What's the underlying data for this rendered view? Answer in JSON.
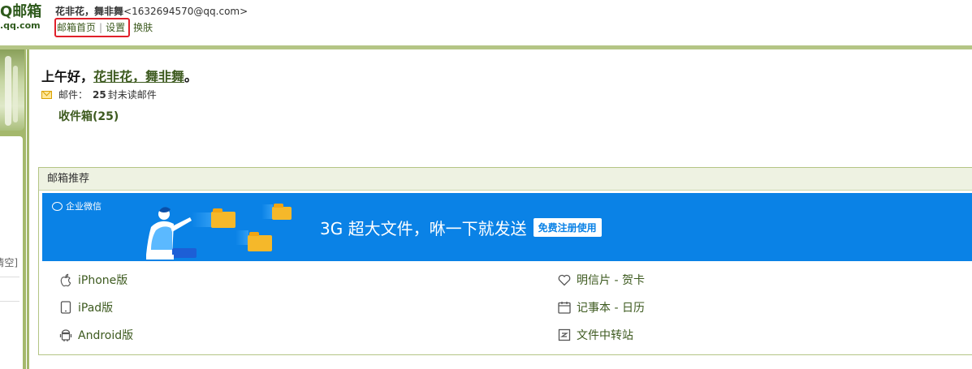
{
  "header": {
    "logo_main": "Q邮箱",
    "logo_sub": ".qq.com",
    "user_name": "花非花，舞非舞",
    "user_email": "<1632694570@qq.com>",
    "links": {
      "home": "邮箱首页",
      "separator": "|",
      "settings": "设置",
      "skin": "换肤"
    }
  },
  "sidebar": {
    "clear_label": "清空]"
  },
  "main": {
    "greeting_prefix": "上午好，",
    "greeting_name": "花非花，舞非舞",
    "greeting_suffix": "。",
    "mail_label": "邮件：",
    "mail_count": "25",
    "mail_unit": "封未读邮件",
    "inbox_label": "收件箱(25)"
  },
  "recommend": {
    "title": "邮箱推荐",
    "banner": {
      "brand": "企业微信",
      "headline": "3G 超大文件，咻一下就发送",
      "button": "免费注册使用"
    },
    "items_left": [
      {
        "label": "iPhone版",
        "icon": "apple-icon"
      },
      {
        "label": "iPad版",
        "icon": "tablet-icon"
      },
      {
        "label": "Android版",
        "icon": "android-icon"
      }
    ],
    "items_right": [
      {
        "label": "明信片 - 贺卡",
        "icon": "heart-icon"
      },
      {
        "label": "记事本 - 日历",
        "icon": "calendar-icon"
      },
      {
        "label": "文件中转站",
        "icon": "file-transfer-icon"
      }
    ]
  },
  "colors": {
    "accent_green": "#3d5a1f",
    "border_green": "#a4b86c",
    "banner_blue": "#0a82e6",
    "highlight_red": "#e0202a"
  }
}
